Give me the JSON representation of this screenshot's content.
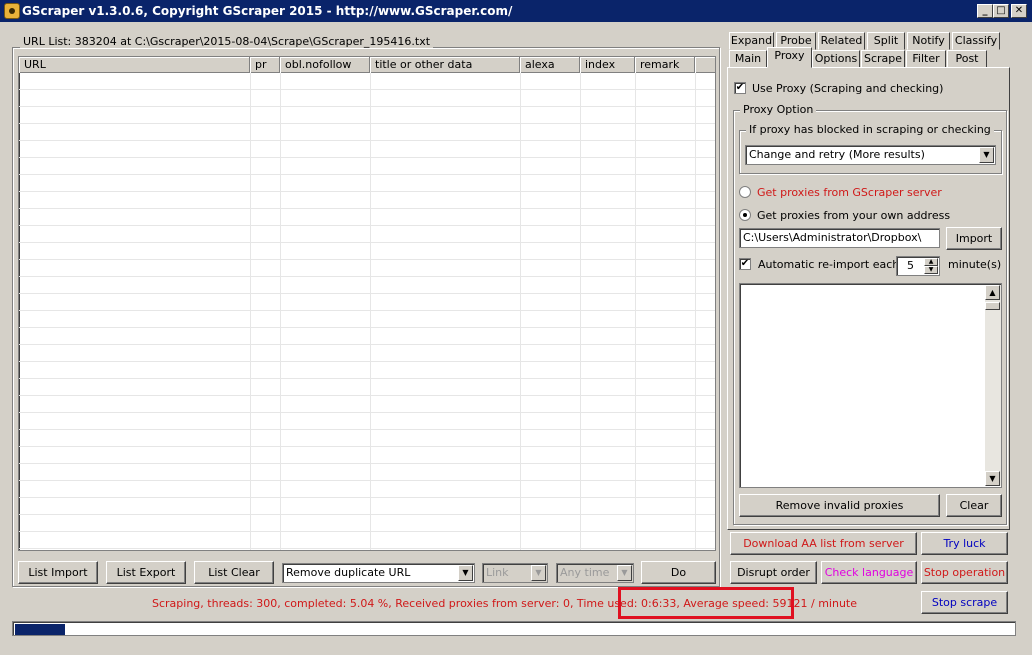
{
  "window": {
    "title": "GScraper v1.3.0.6, Copyright GScraper 2015 - http://www.GScraper.com/"
  },
  "urllist": {
    "label": "URL List: 383204 at C:\\Gscraper\\2015-08-04\\Scrape\\GScraper_195416.txt",
    "columns": [
      "URL",
      "pr",
      "obl.nofollow",
      "title or other data",
      "alexa",
      "index",
      "remark"
    ]
  },
  "bottom": {
    "list_import": "List Import",
    "list_export": "List Export",
    "list_clear": "List Clear",
    "action_select": "Remove duplicate URL",
    "link_select": "Link",
    "time_select": "Any time",
    "do": "Do"
  },
  "tabs": {
    "row1": [
      "Expand",
      "Probe",
      "Related",
      "Split",
      "Notify",
      "Classify"
    ],
    "row2": [
      "Main",
      "Proxy",
      "Options",
      "Scrape",
      "Filter",
      "Post"
    ],
    "active": "Proxy"
  },
  "proxy": {
    "use_proxy": "Use Proxy (Scraping and checking)",
    "use_proxy_checked": true,
    "proxy_option": "Proxy Option",
    "blocked_group": "If proxy has blocked in scraping or checking",
    "blocked_select": "Change and retry (More results)",
    "radio_server": "Get proxies from GScraper server",
    "radio_own": "Get proxies from your own address",
    "selected_radio": "own",
    "address": "C:\\Users\\Administrator\\Dropbox\\",
    "import": "Import",
    "auto_reimport": "Automatic re-import each",
    "auto_reimport_checked": true,
    "minutes_value": "5",
    "minutes_label": "minute(s)",
    "remove_invalid": "Remove invalid proxies",
    "clear": "Clear"
  },
  "actions": {
    "download_aa": "Download AA list from server",
    "try_luck": "Try luck",
    "disrupt_order": "Disrupt order",
    "check_language": "Check language",
    "stop_operation": "Stop operation",
    "stop_scrape": "Stop scrape"
  },
  "status": {
    "text": "Scraping, threads: 300, completed: 5.04 %, Received proxies from server: 0, Time used: 0:6:33, Average speed: 59121 / minute",
    "progress_percent": 5.04
  },
  "colors": {
    "title_bar": "#0a246a",
    "alert_text": "#d01818",
    "highlight_box": "#e01020",
    "link_text": "#0000c0"
  }
}
